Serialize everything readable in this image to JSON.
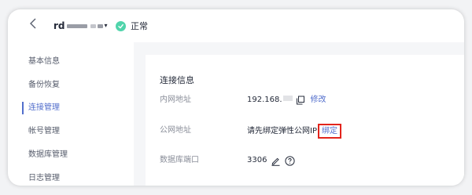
{
  "header": {
    "back_icon": "chevron-left-icon",
    "instance_name": "rd",
    "status_text": "正常",
    "status_color": "#50d4ab"
  },
  "sidebar": {
    "items": [
      {
        "label": "基本信息",
        "active": false
      },
      {
        "label": "备份恢复",
        "active": false
      },
      {
        "label": "连接管理",
        "active": true
      },
      {
        "label": "帐号管理",
        "active": false
      },
      {
        "label": "数据库管理",
        "active": false
      },
      {
        "label": "日志管理",
        "active": false
      }
    ],
    "active_color": "#526ecc"
  },
  "connection": {
    "section_title": "连接信息",
    "private_address_label": "内网地址",
    "private_address_value": "192.168.",
    "modify_link": "修改",
    "public_address_label": "公网地址",
    "public_address_value": "请先绑定弹性公网IP",
    "bind_link": "绑定",
    "highlight_color": "#e2241c",
    "port_label": "数据库端口",
    "port_value": "3306"
  }
}
